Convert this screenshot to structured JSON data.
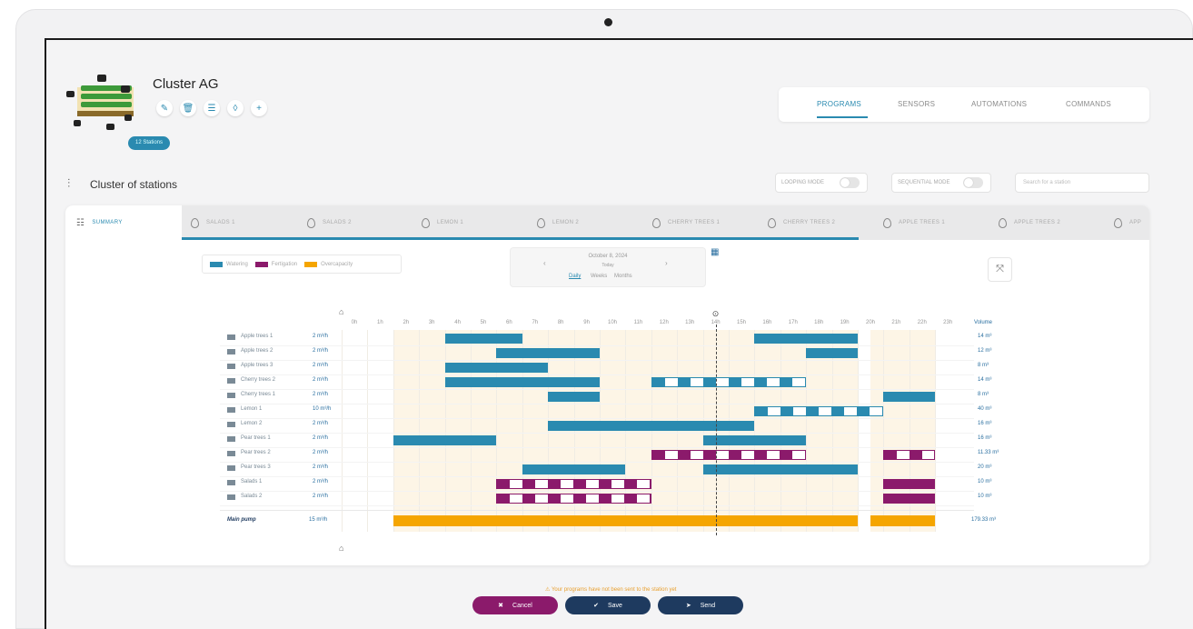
{
  "cluster": {
    "title": "Cluster AG",
    "badge": "12 Stations",
    "section_title": "Cluster of stations",
    "actions": [
      "edit-icon",
      "delete-icon",
      "list-icon",
      "drop-icon",
      "add-icon"
    ]
  },
  "topnav": {
    "items": [
      {
        "label": "PROGRAMS",
        "active": true
      },
      {
        "label": "SENSORS",
        "active": false
      },
      {
        "label": "AUTOMATIONS",
        "active": false
      },
      {
        "label": "COMMANDS",
        "active": false
      }
    ]
  },
  "controls": {
    "looping_label": "LOOPING MODE",
    "sequential_label": "SEQUENTIAL MODE",
    "search_placeholder": "Search for a station"
  },
  "tabs": [
    {
      "label": "SUMMARY",
      "active": true
    },
    {
      "label": "SALADS 1"
    },
    {
      "label": "SALADS 2"
    },
    {
      "label": "LEMON 1"
    },
    {
      "label": "LEMON 2"
    },
    {
      "label": "CHERRY TREES 1"
    },
    {
      "label": "CHERRY TREES 2"
    },
    {
      "label": "APPLE TREES 1"
    },
    {
      "label": "APPLE TREES 2"
    },
    {
      "label": "APP"
    }
  ],
  "legend": [
    {
      "label": "Watering",
      "color": "#2a8ab0"
    },
    {
      "label": "Fertigation",
      "color": "#8b1a6b"
    },
    {
      "label": "Overcapacity",
      "color": "#f5a500"
    }
  ],
  "date": {
    "value": "October 8, 2024",
    "sub": "Today",
    "modes": [
      "Daily",
      "Weeks",
      "Months"
    ],
    "active_mode": "Daily"
  },
  "schedule": {
    "hours": [
      "0h",
      "1h",
      "2h",
      "3h",
      "4h",
      "5h",
      "6h",
      "7h",
      "8h",
      "9h",
      "10h",
      "11h",
      "12h",
      "13h",
      "14h",
      "15h",
      "16h",
      "17h",
      "18h",
      "19h",
      "20h",
      "21h",
      "22h",
      "23h"
    ],
    "volume_header": "Volume",
    "now_hour": 14.5,
    "rows": [
      {
        "name": "Apple trees 1",
        "rate": "2 m³/h",
        "volume": "14 m³",
        "bars": [
          [
            4,
            7,
            "w",
            false
          ],
          [
            16,
            20,
            "w",
            false
          ]
        ]
      },
      {
        "name": "Apple trees 2",
        "rate": "2 m³/h",
        "volume": "12 m³",
        "bars": [
          [
            6,
            10,
            "w",
            false
          ],
          [
            18,
            20,
            "w",
            false
          ]
        ]
      },
      {
        "name": "Apple trees 3",
        "rate": "2 m³/h",
        "volume": "8 m³",
        "bars": [
          [
            4,
            8,
            "w",
            false
          ]
        ]
      },
      {
        "name": "Cherry trees 2",
        "rate": "2 m³/h",
        "volume": "14 m³",
        "bars": [
          [
            4,
            10,
            "w",
            false
          ],
          [
            12,
            18,
            "w",
            true
          ]
        ]
      },
      {
        "name": "Cherry trees 1",
        "rate": "2 m³/h",
        "volume": "8 m³",
        "bars": [
          [
            8,
            10,
            "w",
            false
          ],
          [
            21,
            23,
            "w",
            false
          ]
        ]
      },
      {
        "name": "Lemon 1",
        "rate": "10 m³/h",
        "volume": "40 m³",
        "bars": [
          [
            16,
            21,
            "w",
            true
          ]
        ]
      },
      {
        "name": "Lemon 2",
        "rate": "2 m³/h",
        "volume": "16 m³",
        "bars": [
          [
            8,
            16,
            "w",
            false
          ]
        ]
      },
      {
        "name": "Pear trees 1",
        "rate": "2 m³/h",
        "volume": "16 m³",
        "bars": [
          [
            2,
            6,
            "w",
            false
          ],
          [
            14,
            18,
            "w",
            false
          ]
        ]
      },
      {
        "name": "Pear trees 2",
        "rate": "2 m³/h",
        "volume": "11.33 m³",
        "bars": [
          [
            12,
            18,
            "f",
            true
          ],
          [
            21,
            23,
            "f",
            true
          ]
        ]
      },
      {
        "name": "Pear trees 3",
        "rate": "2 m³/h",
        "volume": "20 m³",
        "bars": [
          [
            7,
            11,
            "w",
            false
          ],
          [
            14,
            20,
            "w",
            false
          ]
        ]
      },
      {
        "name": "Salads 1",
        "rate": "2 m³/h",
        "volume": "10 m³",
        "bars": [
          [
            6,
            12,
            "f",
            true
          ],
          [
            21,
            23,
            "f",
            false
          ]
        ]
      },
      {
        "name": "Salads 2",
        "rate": "2 m³/h",
        "volume": "10 m³",
        "bars": [
          [
            6,
            12,
            "f",
            true
          ],
          [
            21,
            23,
            "f",
            false
          ]
        ]
      }
    ],
    "pump": {
      "name": "Main pump",
      "rate": "15 m³/h",
      "volume": "179.33 m³",
      "bars": [
        [
          2,
          20
        ],
        [
          20.5,
          23
        ]
      ]
    }
  },
  "footer": {
    "warning": "Your programs have not been sent to the station yet",
    "cancel": "Cancel",
    "save": "Save",
    "send": "Send",
    "colors": {
      "cancel": "#8b1a6b",
      "save": "#1e3a5f",
      "send": "#1e3a5f"
    }
  }
}
